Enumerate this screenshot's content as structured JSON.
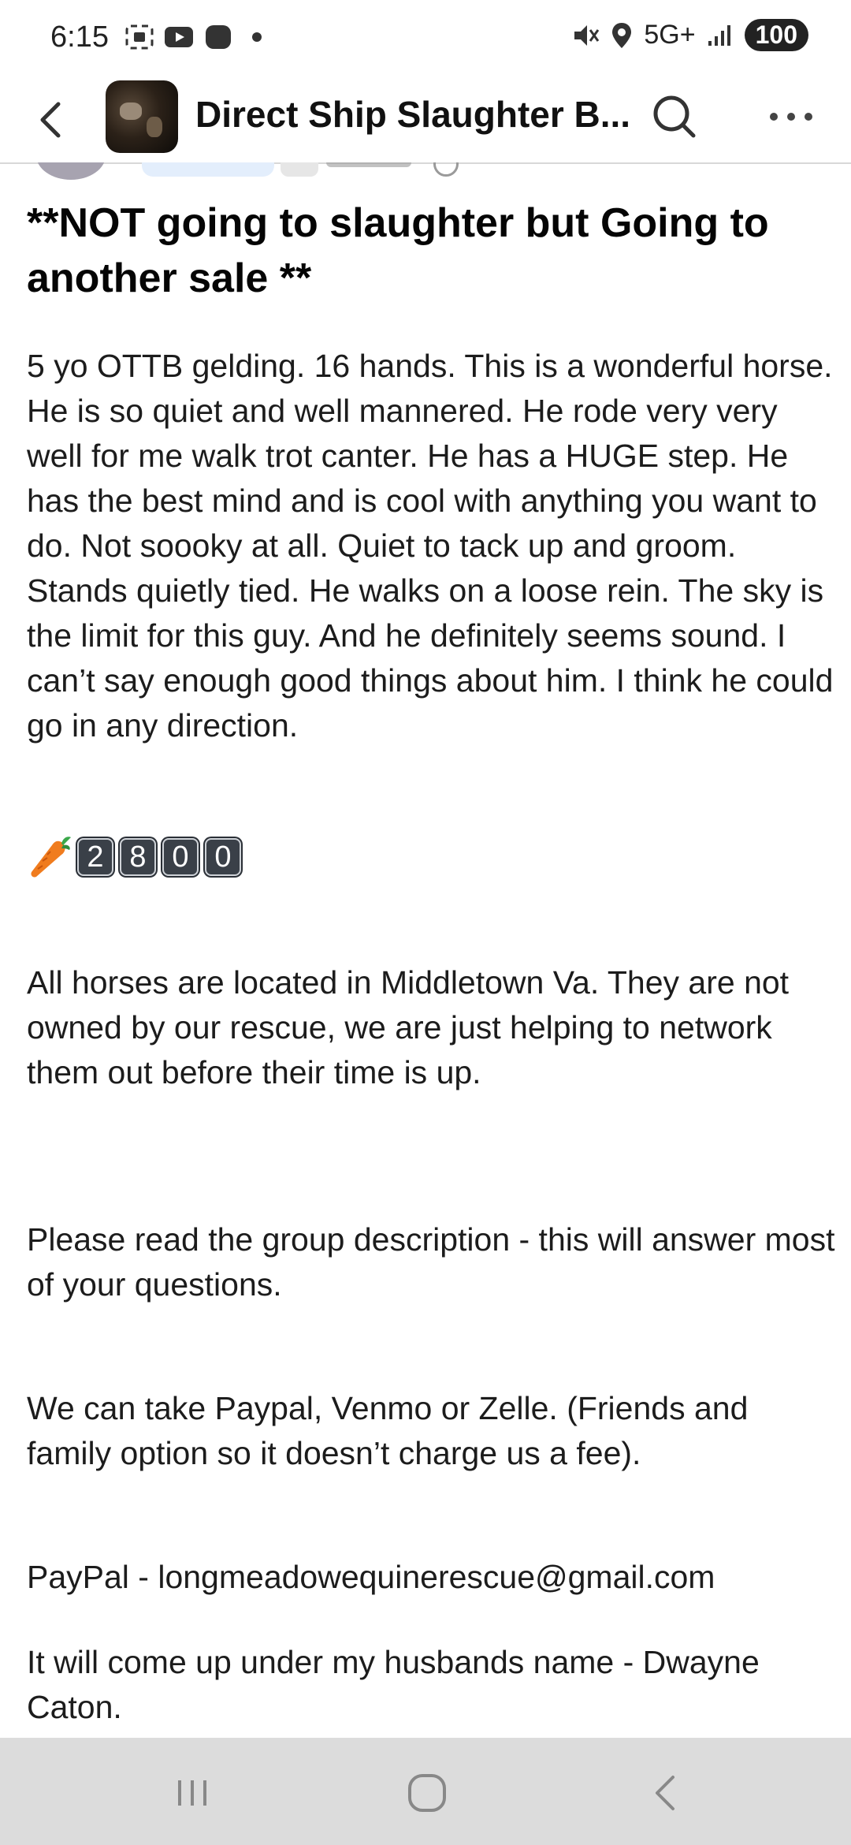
{
  "status_bar": {
    "time": "6:15",
    "network": "5G+",
    "battery": "100"
  },
  "header": {
    "group_title": "Direct Ship Slaughter B...",
    "icons": [
      "back-icon",
      "search-icon",
      "more-icon"
    ]
  },
  "post": {
    "title": "**NOT going to slaughter but Going to another sale **",
    "paragraph_1": "5 yo OTTB gelding. 16 hands. This is a wonderful horse. He is so quiet and well mannered. He rode very very well for me walk trot canter. He has a HUGE step. He has the best mind and is cool with anything you want to do. Not soooky at all.  Quiet to tack up and groom. Stands quietly tied. He walks on a loose rein. The sky is the limit for this guy. And he definitely seems sound.  I can’t say enough good things about him.  I think he could go in any direction.",
    "price_digits": [
      "2",
      "8",
      "0",
      "0"
    ],
    "paragraph_2": "All horses are located in Middletown Va.  They are not owned by our rescue, we are just helping to network them out before their time is up.",
    "paragraph_3": "Please read the group description - this will answer most of your questions.",
    "paragraph_4": "We can take Paypal, Venmo or Zelle.  (Friends and family option so it doesn’t charge us a fee).",
    "paragraph_5": "PayPal - longmeadowequinerescue@gmail.com",
    "paragraph_6": "It will come up under my husbands name - Dwayne Caton."
  },
  "colors": {
    "nav_bar": "#dcdcdc",
    "keycap": "#2a2f36",
    "carrot": "#f07c1e"
  }
}
